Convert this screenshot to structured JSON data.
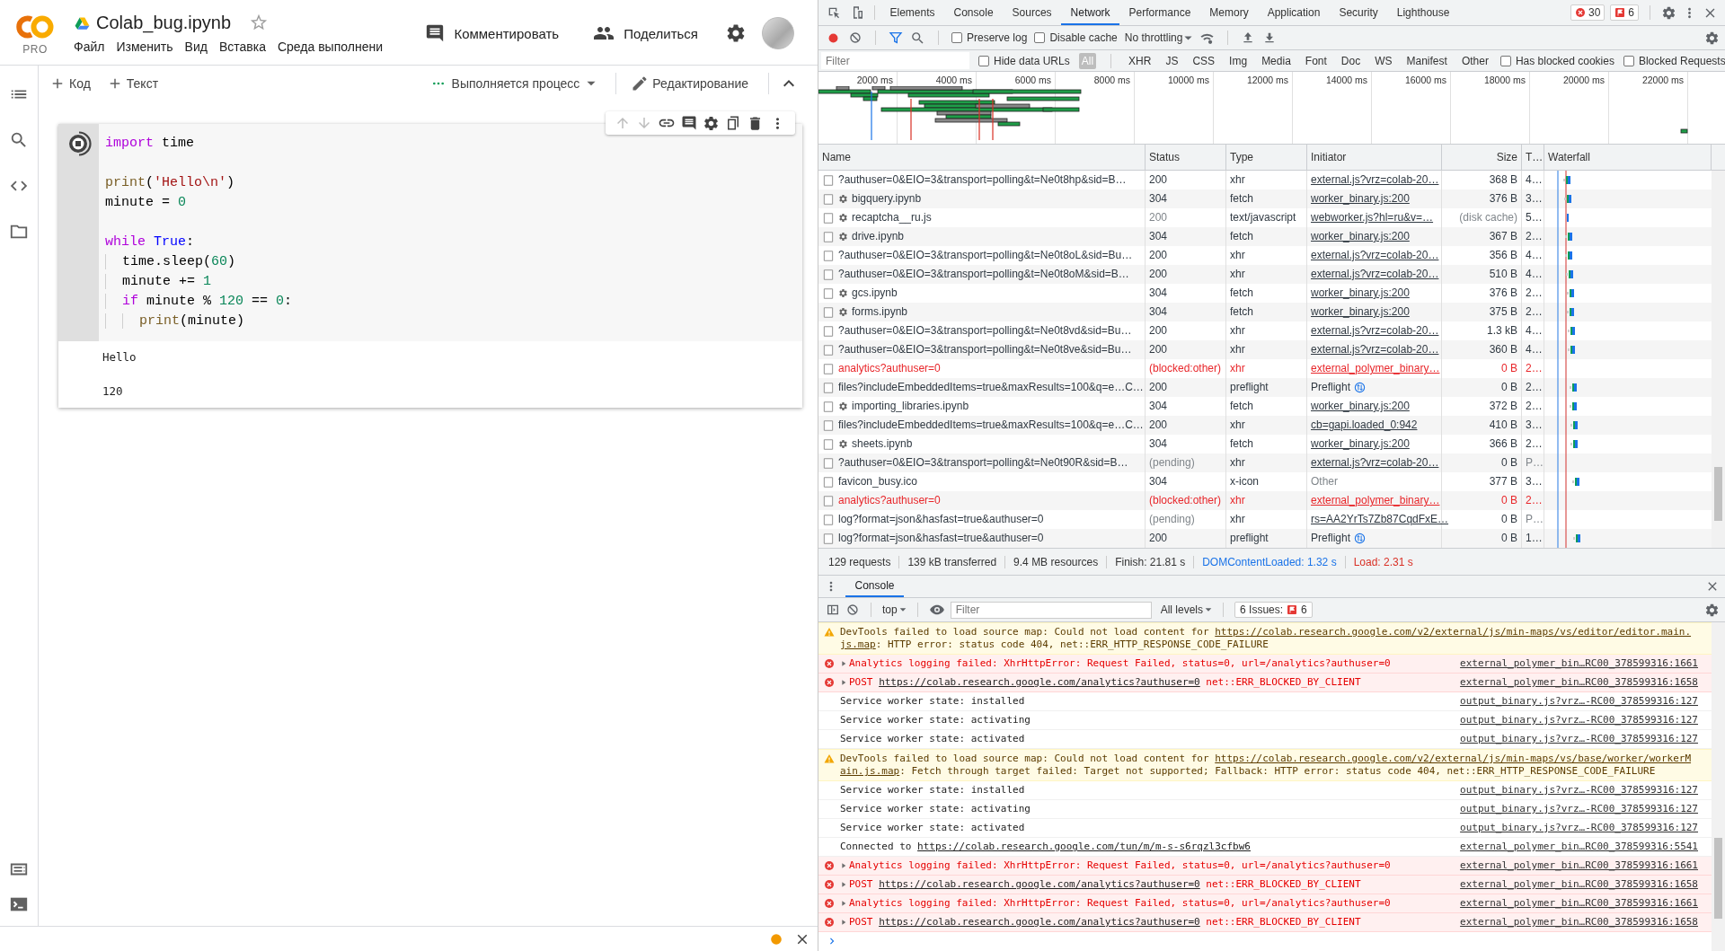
{
  "colab": {
    "logo_badge": "PRO",
    "title": "Colab_bug.ipynb",
    "starred": false,
    "menu": [
      "Файл",
      "Изменить",
      "Вид",
      "Вставка",
      "Среда выполнени"
    ],
    "comment_button": "Комментировать",
    "share_button": "Поделиться",
    "toolbar": {
      "add_code": "Код",
      "add_text": "Текст",
      "runtime_status": "Выполняется процесс",
      "mode": "Редактирование"
    },
    "cell": {
      "running": true,
      "code": [
        {
          "kind": "code",
          "tokens": [
            {
              "text": "import",
              "kind": "keyword"
            },
            {
              "text": " time",
              "kind": "plain"
            }
          ]
        },
        {
          "kind": "blank"
        },
        {
          "kind": "code",
          "tokens": [
            {
              "text": "print",
              "kind": "builtin"
            },
            {
              "text": "(",
              "kind": "plain"
            },
            {
              "text": "'Hello\\n'",
              "kind": "string"
            },
            {
              "text": ")",
              "kind": "plain"
            }
          ]
        },
        {
          "kind": "code",
          "tokens": [
            {
              "text": "minute = ",
              "kind": "plain"
            },
            {
              "text": "0",
              "kind": "number"
            }
          ]
        },
        {
          "kind": "blank"
        },
        {
          "kind": "code",
          "tokens": [
            {
              "text": "while",
              "kind": "keyword"
            },
            {
              "text": " True",
              "kind": "constant"
            },
            {
              "text": ":",
              "kind": "plain"
            }
          ]
        },
        {
          "kind": "code",
          "tokens": [
            {
              "text": "  time.sleep(",
              "kind": "plain"
            },
            {
              "text": "60",
              "kind": "number"
            },
            {
              "text": ")",
              "kind": "plain"
            }
          ]
        },
        {
          "kind": "code",
          "tokens": [
            {
              "text": "  minute += ",
              "kind": "plain"
            },
            {
              "text": "1",
              "kind": "number"
            }
          ]
        },
        {
          "kind": "code",
          "tokens": [
            {
              "text": "  if",
              "kind": "keyword"
            },
            {
              "text": " minute % ",
              "kind": "plain"
            },
            {
              "text": "120",
              "kind": "number"
            },
            {
              "text": " == ",
              "kind": "plain"
            },
            {
              "text": "0",
              "kind": "number"
            },
            {
              "text": ":",
              "kind": "plain"
            }
          ]
        },
        {
          "kind": "code",
          "tokens": [
            {
              "text": "    print",
              "kind": "builtin"
            },
            {
              "text": "(minute)",
              "kind": "plain"
            }
          ]
        }
      ],
      "output": "Hello\n\n120"
    }
  },
  "devtools": {
    "tabs": [
      {
        "label": "Elements",
        "selected": false
      },
      {
        "label": "Console",
        "selected": false
      },
      {
        "label": "Sources",
        "selected": false
      },
      {
        "label": "Network",
        "selected": true
      },
      {
        "label": "Performance",
        "selected": false
      },
      {
        "label": "Memory",
        "selected": false
      },
      {
        "label": "Application",
        "selected": false
      },
      {
        "label": "Security",
        "selected": false
      },
      {
        "label": "Lighthouse",
        "selected": false
      }
    ],
    "error_count": "30",
    "issue_count": "6",
    "network": {
      "toolbar_checkboxes": [
        {
          "label": "Preserve log",
          "checked": false
        },
        {
          "label": "Disable cache",
          "checked": false
        }
      ],
      "throttling": "No throttling",
      "filter_placeholder": "Filter",
      "hide_data_urls": {
        "label": "Hide data URLs",
        "checked": false
      },
      "type_filters": [
        {
          "label": "All",
          "selected": true
        },
        {
          "label": "XHR",
          "selected": false
        },
        {
          "label": "JS",
          "selected": false
        },
        {
          "label": "CSS",
          "selected": false
        },
        {
          "label": "Img",
          "selected": false
        },
        {
          "label": "Media",
          "selected": false
        },
        {
          "label": "Font",
          "selected": false
        },
        {
          "label": "Doc",
          "selected": false
        },
        {
          "label": "WS",
          "selected": false
        },
        {
          "label": "Manifest",
          "selected": false
        },
        {
          "label": "Other",
          "selected": false
        }
      ],
      "extra_checkboxes": [
        {
          "label": "Has blocked cookies",
          "checked": false
        },
        {
          "label": "Blocked Requests",
          "checked": false
        }
      ],
      "timeline_ticks": [
        "2000 ms",
        "4000 ms",
        "6000 ms",
        "8000 ms",
        "10000 ms",
        "12000 ms",
        "14000 ms",
        "16000 ms",
        "18000 ms",
        "20000 ms",
        "22000 ms"
      ],
      "columns": [
        "Name",
        "Status",
        "Type",
        "Initiator",
        "Size",
        "T…",
        "Waterfall"
      ],
      "rows": [
        {
          "kind": "ok",
          "name": "?authuser=0&EIO=3&transport=polling&t=Ne0t8hp&sid=B…",
          "service_worker": false,
          "status": "200",
          "type": "xhr",
          "initiator": {
            "kind": "link",
            "text": "external.js?vrz=colab-20…"
          },
          "size": "368 B",
          "time": "4…"
        },
        {
          "kind": "ok",
          "name": "bigquery.ipynb",
          "service_worker": true,
          "status": "304",
          "type": "fetch",
          "initiator": {
            "kind": "link",
            "text": "worker_binary.js:200"
          },
          "size": "376 B",
          "time": "3…"
        },
        {
          "kind": "cached",
          "name": "recaptcha__ru.js",
          "service_worker": true,
          "status": "200",
          "type": "text/javascript",
          "initiator": {
            "kind": "link",
            "text": "webworker.js?hl=ru&v=…"
          },
          "size": "(disk cache)",
          "time": "5…"
        },
        {
          "kind": "ok",
          "name": "drive.ipynb",
          "service_worker": true,
          "status": "304",
          "type": "fetch",
          "initiator": {
            "kind": "link",
            "text": "worker_binary.js:200"
          },
          "size": "367 B",
          "time": "2…"
        },
        {
          "kind": "ok",
          "name": "?authuser=0&EIO=3&transport=polling&t=Ne0t8oL&sid=Bu…",
          "service_worker": false,
          "status": "200",
          "type": "xhr",
          "initiator": {
            "kind": "link",
            "text": "external.js?vrz=colab-20…"
          },
          "size": "356 B",
          "time": "4…"
        },
        {
          "kind": "ok",
          "name": "?authuser=0&EIO=3&transport=polling&t=Ne0t8oM&sid=B…",
          "service_worker": false,
          "status": "200",
          "type": "xhr",
          "initiator": {
            "kind": "link",
            "text": "external.js?vrz=colab-20…"
          },
          "size": "510 B",
          "time": "4…"
        },
        {
          "kind": "ok",
          "name": "gcs.ipynb",
          "service_worker": true,
          "status": "304",
          "type": "fetch",
          "initiator": {
            "kind": "link",
            "text": "worker_binary.js:200"
          },
          "size": "376 B",
          "time": "2…"
        },
        {
          "kind": "ok",
          "name": "forms.ipynb",
          "service_worker": true,
          "status": "304",
          "type": "fetch",
          "initiator": {
            "kind": "link",
            "text": "worker_binary.js:200"
          },
          "size": "375 B",
          "time": "2…"
        },
        {
          "kind": "ok",
          "name": "?authuser=0&EIO=3&transport=polling&t=Ne0t8vd&sid=Bu…",
          "service_worker": false,
          "status": "200",
          "type": "xhr",
          "initiator": {
            "kind": "link",
            "text": "external.js?vrz=colab-20…"
          },
          "size": "1.3 kB",
          "time": "4…"
        },
        {
          "kind": "ok",
          "name": "?authuser=0&EIO=3&transport=polling&t=Ne0t8ve&sid=Bu…",
          "service_worker": false,
          "status": "200",
          "type": "xhr",
          "initiator": {
            "kind": "link",
            "text": "external.js?vrz=colab-20…"
          },
          "size": "360 B",
          "time": "4…"
        },
        {
          "kind": "blocked",
          "name": "analytics?authuser=0",
          "service_worker": false,
          "status": "(blocked:other)",
          "type": "xhr",
          "initiator": {
            "kind": "link",
            "text": "external_polymer_binary…"
          },
          "size": "0 B",
          "time": "2…"
        },
        {
          "kind": "ok",
          "name": "files?includeEmbeddedItems=true&maxResults=100&q=e…C…",
          "service_worker": false,
          "status": "200",
          "type": "preflight",
          "initiator": {
            "kind": "preflight",
            "text": "Preflight"
          },
          "size": "0 B",
          "time": "2…"
        },
        {
          "kind": "ok",
          "name": "importing_libraries.ipynb",
          "service_worker": true,
          "status": "304",
          "type": "fetch",
          "initiator": {
            "kind": "link",
            "text": "worker_binary.js:200"
          },
          "size": "372 B",
          "time": "2…"
        },
        {
          "kind": "ok",
          "name": "files?includeEmbeddedItems=true&maxResults=100&q=e…C…",
          "service_worker": false,
          "status": "200",
          "type": "xhr",
          "initiator": {
            "kind": "link",
            "text": "cb=gapi.loaded_0:942"
          },
          "size": "410 B",
          "time": "3…"
        },
        {
          "kind": "ok",
          "name": "sheets.ipynb",
          "service_worker": true,
          "status": "304",
          "type": "fetch",
          "initiator": {
            "kind": "link",
            "text": "worker_binary.js:200"
          },
          "size": "366 B",
          "time": "2…"
        },
        {
          "kind": "pending",
          "name": "?authuser=0&EIO=3&transport=polling&t=Ne0t90R&sid=B…",
          "service_worker": false,
          "status": "(pending)",
          "type": "xhr",
          "initiator": {
            "kind": "link",
            "text": "external.js?vrz=colab-20…"
          },
          "size": "0 B",
          "time": "P…"
        },
        {
          "kind": "ok",
          "name": "favicon_busy.ico",
          "service_worker": false,
          "status": "304",
          "type": "x-icon",
          "initiator": {
            "kind": "other",
            "text": "Other"
          },
          "size": "377 B",
          "time": "3…"
        },
        {
          "kind": "blocked",
          "name": "analytics?authuser=0",
          "service_worker": false,
          "status": "(blocked:other)",
          "type": "xhr",
          "initiator": {
            "kind": "link",
            "text": "external_polymer_binary…"
          },
          "size": "0 B",
          "time": "2…"
        },
        {
          "kind": "pending",
          "name": "log?format=json&hasfast=true&authuser=0",
          "service_worker": false,
          "status": "(pending)",
          "type": "xhr",
          "initiator": {
            "kind": "link",
            "text": "rs=AA2YrTs7Zb87CqdFxE…"
          },
          "size": "0 B",
          "time": "P…"
        },
        {
          "kind": "ok",
          "name": "log?format=json&hasfast=true&authuser=0",
          "service_worker": false,
          "status": "200",
          "type": "preflight",
          "initiator": {
            "kind": "preflight",
            "text": "Preflight"
          },
          "size": "0 B",
          "time": "1…"
        }
      ],
      "summary": [
        {
          "text": "129 requests",
          "kind": "plain"
        },
        {
          "text": "139 kB transferred",
          "kind": "plain"
        },
        {
          "text": "9.4 MB resources",
          "kind": "plain"
        },
        {
          "text": "Finish: 21.81 s",
          "kind": "plain"
        },
        {
          "text": "DOMContentLoaded: 1.32 s",
          "kind": "dom"
        },
        {
          "text": "Load: 2.31 s",
          "kind": "load"
        }
      ]
    },
    "console": {
      "tab": {
        "label": "Console",
        "selected": true
      },
      "context": "top",
      "filter_placeholder": "Filter",
      "levels": "All levels",
      "issues_label": "6 Issues:",
      "issues_count": "6",
      "messages": [
        {
          "kind": "warning",
          "expandable": false,
          "parts": [
            {
              "text": "DevTools failed to load source map: Could not load content for "
            },
            {
              "link": "https://colab.research.google.com/v2/external/js/min-maps/vs/editor/editor.main."
            },
            {
              "link": "js.map"
            },
            {
              "text": ": HTTP error: status code 404, net::ERR_HTTP_RESPONSE_CODE_FAILURE"
            }
          ]
        },
        {
          "kind": "error",
          "expandable": true,
          "parts": [
            {
              "text": "Analytics logging failed: XhrHttpError: Request Failed, status=0, url=/analytics?authuser=0"
            }
          ],
          "source": "external_polymer_bin…RC00_378599316:1661"
        },
        {
          "kind": "error",
          "expandable": true,
          "parts": [
            {
              "text": "POST "
            },
            {
              "link": "https://colab.research.google.com/analytics?authuser=0"
            },
            {
              "text": " net::ERR_BLOCKED_BY_CLIENT"
            }
          ],
          "source": "external_polymer_bin…RC00_378599316:1658"
        },
        {
          "kind": "info",
          "expandable": false,
          "parts": [
            {
              "text": "Service worker state: installed"
            }
          ],
          "source": "output_binary.js?vrz…-RC00_378599316:127"
        },
        {
          "kind": "info",
          "expandable": false,
          "parts": [
            {
              "text": "Service worker state: activating"
            }
          ],
          "source": "output_binary.js?vrz…-RC00_378599316:127"
        },
        {
          "kind": "info",
          "expandable": false,
          "parts": [
            {
              "text": "Service worker state: activated"
            }
          ],
          "source": "output_binary.js?vrz…-RC00_378599316:127"
        },
        {
          "kind": "warning",
          "expandable": false,
          "parts": [
            {
              "text": "DevTools failed to load source map: Could not load content for "
            },
            {
              "link": "https://colab.research.google.com/v2/external/js/min-maps/vs/base/worker/workerM"
            },
            {
              "link": "ain.js.map"
            },
            {
              "text": ": Fetch through target failed: Target not supported; Fallback: HTTP error: status code 404, net::ERR_HTTP_RESPONSE_CODE_FAILURE"
            }
          ]
        },
        {
          "kind": "info",
          "expandable": false,
          "parts": [
            {
              "text": "Service worker state: installed"
            }
          ],
          "source": "output_binary.js?vrz…-RC00_378599316:127"
        },
        {
          "kind": "info",
          "expandable": false,
          "parts": [
            {
              "text": "Service worker state: activating"
            }
          ],
          "source": "output_binary.js?vrz…-RC00_378599316:127"
        },
        {
          "kind": "info",
          "expandable": false,
          "parts": [
            {
              "text": "Service worker state: activated"
            }
          ],
          "source": "output_binary.js?vrz…-RC00_378599316:127"
        },
        {
          "kind": "info",
          "expandable": false,
          "parts": [
            {
              "text": "Connected to "
            },
            {
              "link": "https://colab.research.google.com/tun/m/m-s-s6rqzl3cfbw6"
            }
          ],
          "source": "external_polymer_bin…RC00_378599316:5541"
        },
        {
          "kind": "error",
          "expandable": true,
          "parts": [
            {
              "text": "Analytics logging failed: XhrHttpError: Request Failed, status=0, url=/analytics?authuser=0"
            }
          ],
          "source": "external_polymer_bin…RC00_378599316:1661"
        },
        {
          "kind": "error",
          "expandable": true,
          "parts": [
            {
              "text": "POST "
            },
            {
              "link": "https://colab.research.google.com/analytics?authuser=0"
            },
            {
              "text": " net::ERR_BLOCKED_BY_CLIENT"
            }
          ],
          "source": "external_polymer_bin…RC00_378599316:1658"
        },
        {
          "kind": "error",
          "expandable": true,
          "parts": [
            {
              "text": "Analytics logging failed: XhrHttpError: Request Failed, status=0, url=/analytics?authuser=0"
            }
          ],
          "source": "external_polymer_bin…RC00_378599316:1661"
        },
        {
          "kind": "error",
          "expandable": true,
          "parts": [
            {
              "text": "POST "
            },
            {
              "link": "https://colab.research.google.com/analytics?authuser=0"
            },
            {
              "text": " net::ERR_BLOCKED_BY_CLIENT"
            }
          ],
          "source": "external_polymer_bin…RC00_378599316:1658"
        }
      ]
    }
  }
}
